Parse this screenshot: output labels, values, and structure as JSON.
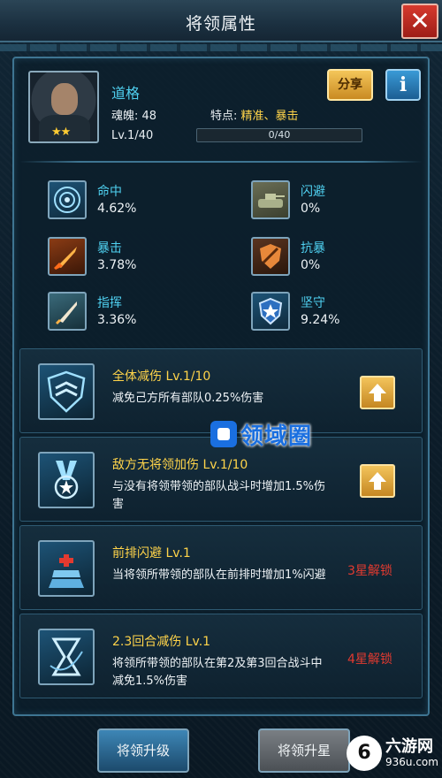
{
  "window": {
    "title": "将领属性",
    "close_glyph": "✕"
  },
  "hero": {
    "name": "道格",
    "soul_label": "魂魄: 48",
    "trait_label": "特点: ",
    "trait_value": "精准、暴击",
    "level_label": "Lv.1/40",
    "exp_text": "0/40",
    "exp_progress": 0,
    "stars": "★★",
    "share_label": "分享",
    "info_label": "i"
  },
  "stats": [
    {
      "label": "命中",
      "value": "4.62%",
      "icon": "target-icon"
    },
    {
      "label": "闪避",
      "value": "0%",
      "icon": "tank-icon"
    },
    {
      "label": "暴击",
      "value": "3.78%",
      "icon": "shell-icon"
    },
    {
      "label": "抗暴",
      "value": "0%",
      "icon": "shield-slash-icon"
    },
    {
      "label": "指挥",
      "value": "3.36%",
      "icon": "rocket-icon"
    },
    {
      "label": "坚守",
      "value": "9.24%",
      "icon": "star-shield-icon"
    }
  ],
  "skills": [
    {
      "name": "全体减伤 Lv.1/10",
      "desc": "减免己方所有部队0.25%伤害",
      "lock": "",
      "icon": "chevron-shield-icon"
    },
    {
      "name": "敌方无将领加伤 Lv.1/10",
      "desc": "与没有将领带领的部队战斗时增加1.5%伤害",
      "lock": "",
      "icon": "medal-icon"
    },
    {
      "name": "前排闪避 Lv.1",
      "desc": "当将领所带领的部队在前排时增加1%闪避",
      "lock": "3星解锁",
      "icon": "grid-icon"
    },
    {
      "name": "2.3回合减伤 Lv.1",
      "desc": "将领所带领的部队在第2及第3回合战斗中减免1.5%伤害",
      "lock": "4星解锁",
      "icon": "hourglass-icon"
    }
  ],
  "watermark": {
    "text": "领域圈"
  },
  "buttons": {
    "upgrade": "将领升级",
    "star_up": "将领升星"
  },
  "site": {
    "name": "六游网",
    "url": "936u.com",
    "glyph": "6"
  },
  "colors": {
    "accent_cyan": "#4fd0f0",
    "gold": "#ffd44a",
    "lock_red": "#e23a30"
  }
}
